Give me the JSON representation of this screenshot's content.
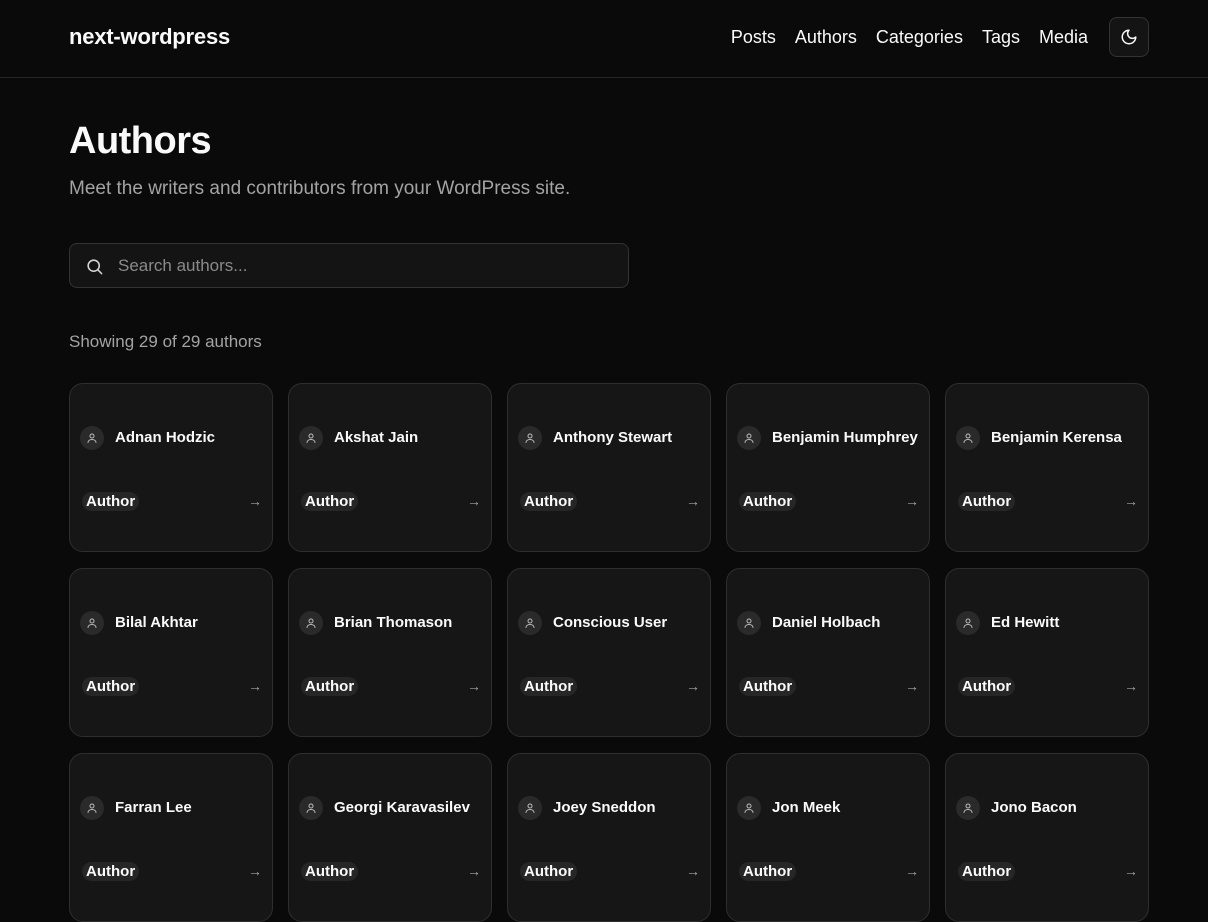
{
  "header": {
    "brand": "next-wordpress",
    "nav": [
      "Posts",
      "Authors",
      "Categories",
      "Tags",
      "Media"
    ],
    "theme_icon": "moon-icon"
  },
  "page": {
    "title": "Authors",
    "subtitle": "Meet the writers and contributors from your WordPress site.",
    "search_placeholder": "Search authors...",
    "count_text": "Showing 29 of 29 authors"
  },
  "authors": [
    {
      "name": "Adnan Hodzic",
      "role": "Author"
    },
    {
      "name": "Akshat Jain",
      "role": "Author"
    },
    {
      "name": "Anthony Stewart",
      "role": "Author"
    },
    {
      "name": "Benjamin Humphrey",
      "role": "Author"
    },
    {
      "name": "Benjamin Kerensa",
      "role": "Author"
    },
    {
      "name": "Bilal Akhtar",
      "role": "Author"
    },
    {
      "name": "Brian Thomason",
      "role": "Author"
    },
    {
      "name": "Conscious User",
      "role": "Author"
    },
    {
      "name": "Daniel Holbach",
      "role": "Author"
    },
    {
      "name": "Ed Hewitt",
      "role": "Author"
    },
    {
      "name": "Farran Lee",
      "role": "Author"
    },
    {
      "name": "Georgi Karavasilev",
      "role": "Author"
    },
    {
      "name": "Joey Sneddon",
      "role": "Author"
    },
    {
      "name": "Jon Meek",
      "role": "Author"
    },
    {
      "name": "Jono Bacon",
      "role": "Author"
    }
  ],
  "card": {
    "arrow": "→",
    "avatar_icon": "user-icon"
  }
}
